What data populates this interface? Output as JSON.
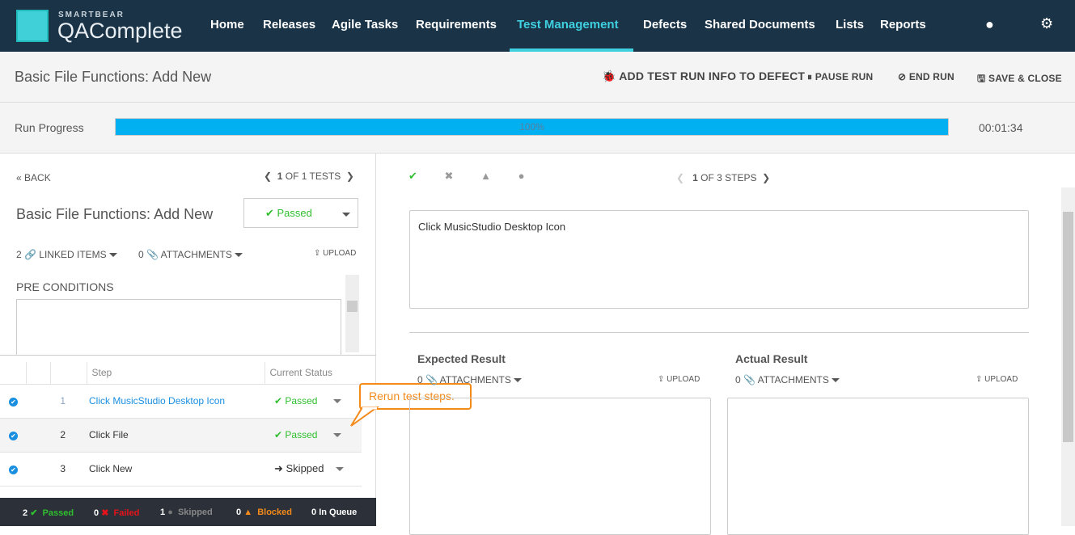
{
  "brand": {
    "company": "SMARTBEAR",
    "product": "QAComplete",
    "mark": "SM"
  },
  "nav": {
    "items": [
      "Home",
      "Releases",
      "Agile Tasks",
      "Requirements",
      "Test Management",
      "Defects",
      "Shared Documents",
      "Lists",
      "Reports"
    ],
    "active": "Test Management"
  },
  "header": {
    "title": "Basic File Functions: Add New",
    "add_defect": "ADD TEST RUN INFO TO DEFECT",
    "pause": "PAUSE RUN",
    "end": "END RUN",
    "save_close": "SAVE & CLOSE"
  },
  "progress": {
    "label": "Run Progress",
    "percent_text": "100%",
    "percent": 100,
    "elapsed": "00:01:34"
  },
  "left": {
    "back": "BACK",
    "test_index": "1",
    "test_of": "OF 1 TESTS",
    "title": "Basic File Functions: Add New",
    "status": "Passed",
    "linked_count": "2",
    "linked_label": "LINKED ITEMS",
    "attach_count": "0",
    "attach_label": "ATTACHMENTS",
    "upload": "UPLOAD",
    "pre_conditions": "PRE CONDITIONS"
  },
  "steps_table": {
    "headers": [
      "Step",
      "Current Status"
    ],
    "rows": [
      {
        "num": "1",
        "step": "Click MusicStudio Desktop Icon",
        "status": "Passed"
      },
      {
        "num": "2",
        "step": "Click File",
        "status": "Passed"
      },
      {
        "num": "3",
        "step": "Click New",
        "status": "Skipped"
      }
    ]
  },
  "summary": {
    "passed_count": "2",
    "passed": "Passed",
    "failed_count": "0",
    "failed": "Failed",
    "skipped_count": "1",
    "skipped": "Skipped",
    "blocked_count": "0",
    "blocked": "Blocked",
    "queue_count": "0",
    "queue": "In Queue"
  },
  "callout": "Rerun test steps.",
  "right": {
    "step_index": "1",
    "step_of": "OF 3 STEPS",
    "step_text": "Click MusicStudio Desktop Icon",
    "expected": "Expected Result",
    "actual": "Actual Result",
    "attach_count": "0",
    "attach_label": "ATTACHMENTS",
    "upload": "UPLOAD"
  },
  "colors": {
    "nav_bg": "#1a3347",
    "accent": "#3fd0e0",
    "progress": "#00b0f0",
    "passed": "#2fbf2f",
    "failed": "#e8121a",
    "blocked": "#f38a1a"
  }
}
